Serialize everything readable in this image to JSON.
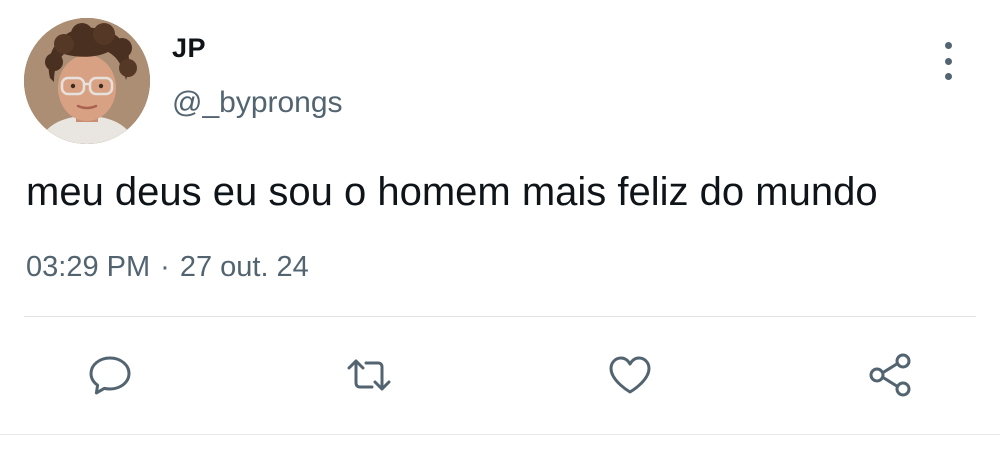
{
  "tweet": {
    "author": {
      "display_name": "JP",
      "handle": "@_byprongs",
      "avatar": "profile-photo"
    },
    "text": "meu deus eu sou o homem mais feliz do mundo",
    "time": "03:29 PM",
    "separator": "·",
    "date": "27 out. 24"
  },
  "actions": [
    {
      "name": "reply",
      "icon": "speech-bubble-icon"
    },
    {
      "name": "retweet",
      "icon": "retweet-icon"
    },
    {
      "name": "like",
      "icon": "heart-icon"
    },
    {
      "name": "share",
      "icon": "share-icon"
    }
  ],
  "colors": {
    "text": "#0f1419",
    "secondary": "#536471",
    "divider": "#dfe3e6",
    "background": "#ffffff"
  }
}
